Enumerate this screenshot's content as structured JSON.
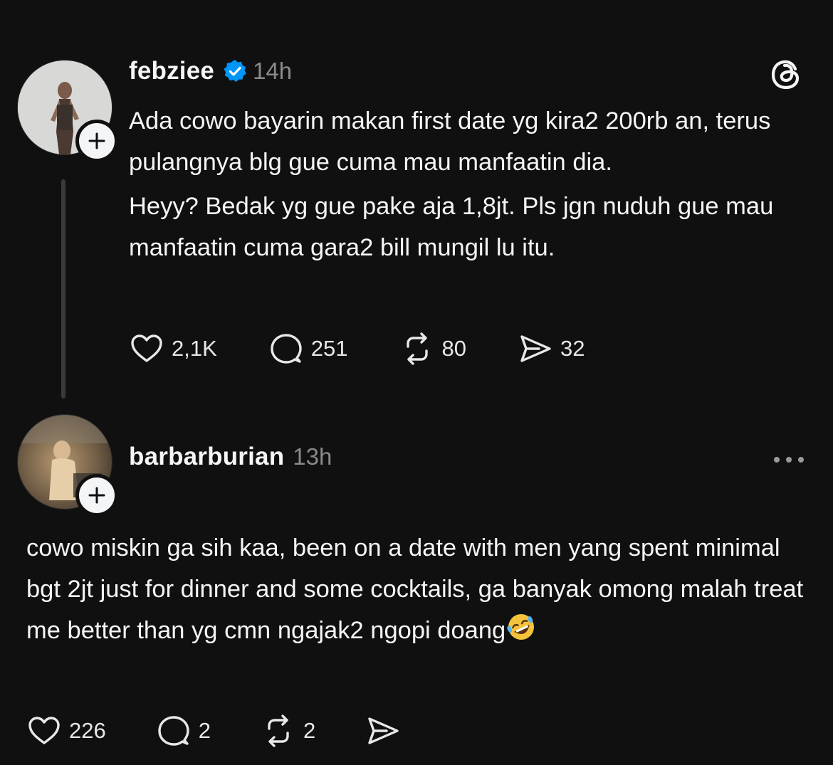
{
  "post": {
    "username": "febziee",
    "time": "14h",
    "verified": true,
    "paragraphs": [
      "Ada cowo bayarin makan first date yg kira2 200rb an, terus pulangnya blg gue cuma mau manfaatin dia.",
      "Heyy? Bedak yg gue pake aja 1,8jt. Pls jgn nuduh gue mau manfaatin cuma gara2 bill mungil lu itu."
    ],
    "likes": "2,1K",
    "replies": "251",
    "reposts": "80",
    "shares": "32"
  },
  "reply": {
    "username": "barbarburian",
    "time": "13h",
    "text": "cowo miskin ga sih kaa, been on a date with men yang spent minimal bgt 2jt just for dinner and some cocktails, ga banyak omong malah treat me better than yg cmn ngajak2 ngopi doang",
    "emoji": "rolling-on-floor-laughing",
    "likes": "226",
    "replies": "2",
    "reposts": "2"
  },
  "colors": {
    "background": "#101010",
    "text": "#f3f5f7",
    "muted": "#8a8a8a",
    "verified": "#0095f6",
    "thread_line": "#3a3a3a"
  },
  "icons": [
    "threads-logo-icon",
    "verified-badge-icon",
    "plus-icon",
    "heart-icon",
    "comment-icon",
    "repost-icon",
    "share-icon",
    "more-icon"
  ]
}
